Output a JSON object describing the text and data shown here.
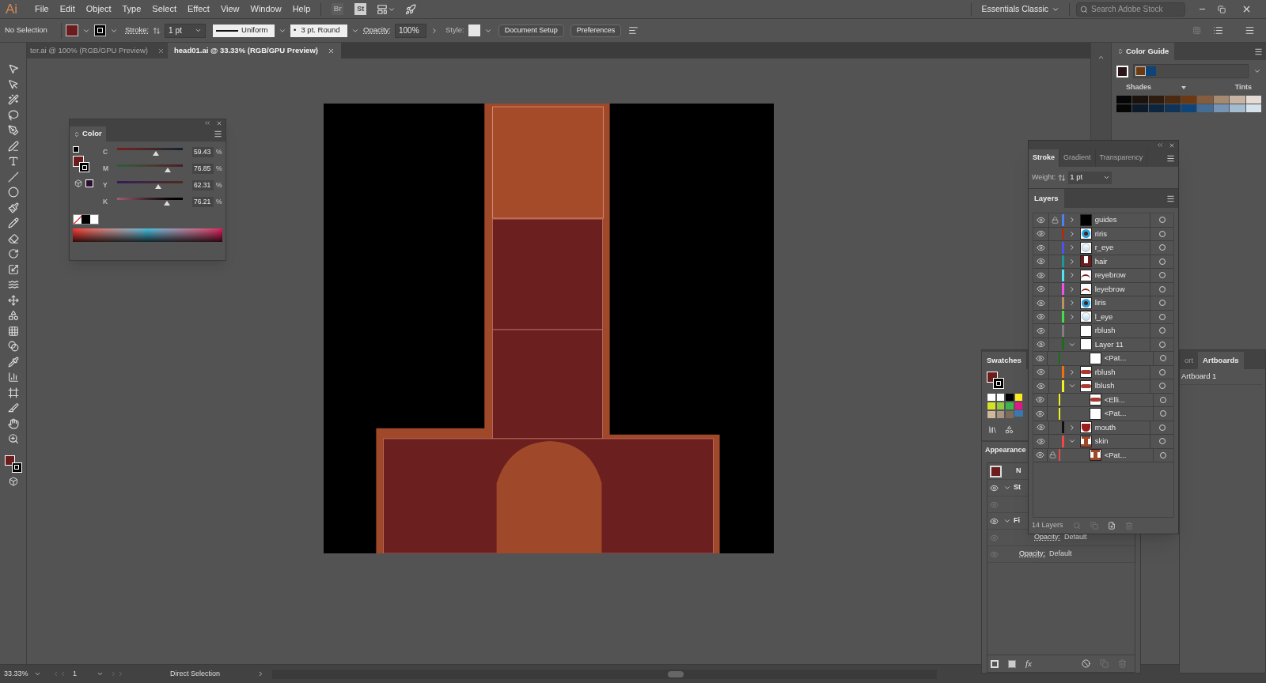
{
  "menu_bar": {
    "logo": "Ai",
    "items": [
      "File",
      "Edit",
      "Object",
      "Type",
      "Select",
      "Effect",
      "View",
      "Window",
      "Help"
    ],
    "app_badges": [
      "Br",
      "St"
    ],
    "workspace": "Essentials Classic",
    "search": {
      "placeholder": "Search Adobe Stock"
    }
  },
  "control_bar": {
    "selection": "No Selection",
    "stroke_label": "Stroke:",
    "stroke_weight": "1 pt",
    "profile": "Uniform",
    "brush_dot": "•",
    "brush": "3 pt. Round",
    "opacity_label": "Opacity:",
    "opacity": "100%",
    "style_label": "Style:",
    "buttons": [
      "Document Setup",
      "Preferences"
    ]
  },
  "document_tabs": [
    {
      "label": "ter.ai @ 100% (RGB/GPU Preview)",
      "selected": false
    },
    {
      "label": "head01.ai @ 33.33% (RGB/GPU Preview)",
      "selected": true
    }
  ],
  "color_panel": {
    "title": "Color",
    "channels": [
      {
        "name": "C",
        "level": 0.5943,
        "value": "59.43",
        "unit": "%"
      },
      {
        "name": "M",
        "level": 0.7685,
        "value": "76.85",
        "unit": "%"
      },
      {
        "name": "Y",
        "level": 0.6231,
        "value": "62.31",
        "unit": "%"
      },
      {
        "name": "K",
        "level": 0.7621,
        "value": "76.21",
        "unit": "%"
      }
    ]
  },
  "color_guide": {
    "title": "Color Guide",
    "shades_label": "Shades",
    "tints_label": "Tints"
  },
  "stroke_panel": {
    "tabs": [
      {
        "label": "Stroke",
        "selected": true
      },
      {
        "label": "Gradient",
        "selected": false
      },
      {
        "label": "Transparency",
        "selected": false
      }
    ],
    "weight_label": "Weight:",
    "weight": "1 pt"
  },
  "layers_panel": {
    "title": "Layers",
    "count": "14 Layers",
    "layers": [
      {
        "name": "guides",
        "color": "#4f7ff0",
        "locked": true,
        "kind": "group",
        "expanded": false
      },
      {
        "name": "riris",
        "color": "#a0311a",
        "locked": false,
        "kind": "group",
        "expanded": false
      },
      {
        "name": "r_eye",
        "color": "#5050f0",
        "locked": false,
        "kind": "group",
        "expanded": false
      },
      {
        "name": "hair",
        "color": "#1b9a9a",
        "locked": false,
        "kind": "group",
        "expanded": false
      },
      {
        "name": "reyebrow",
        "color": "#4ae8f0",
        "locked": false,
        "kind": "group",
        "expanded": false
      },
      {
        "name": "leyebrow",
        "color": "#f050f0",
        "locked": false,
        "kind": "group",
        "expanded": false
      },
      {
        "name": "liris",
        "color": "#c09060",
        "locked": false,
        "kind": "group",
        "expanded": false
      },
      {
        "name": "l_eye",
        "color": "#40e040",
        "locked": false,
        "kind": "group",
        "expanded": false
      },
      {
        "name": "rblush",
        "color": "#808080",
        "locked": false,
        "kind": "plain"
      },
      {
        "name": "Layer 11",
        "color": "#1a6e1a",
        "locked": false,
        "kind": "group",
        "expanded": true,
        "children": [
          {
            "name": "<Pat...",
            "locked": false
          }
        ]
      },
      {
        "name": "rblush",
        "color": "#f07010",
        "locked": false,
        "kind": "group",
        "expanded": false
      },
      {
        "name": "lblush",
        "color": "#f0f020",
        "locked": false,
        "kind": "group",
        "expanded": true,
        "children": [
          {
            "name": "<Elli...",
            "locked": false
          },
          {
            "name": "<Pat...",
            "locked": false
          }
        ]
      },
      {
        "name": "mouth",
        "color": "#101010",
        "locked": false,
        "kind": "group",
        "expanded": false
      },
      {
        "name": "skin",
        "color": "#f04848",
        "locked": false,
        "kind": "group",
        "expanded": true,
        "children": [
          {
            "name": "<Pat...",
            "locked": true
          }
        ]
      }
    ]
  },
  "swatches_panel": {
    "title": "Swatches"
  },
  "appearance_panel": {
    "title": "Appearance",
    "effects_label": "fx",
    "rows": [
      {
        "label": "N",
        "kind": "object"
      },
      {
        "label": "St",
        "kind": "stroke"
      },
      {
        "kind": "empty"
      },
      {
        "label": "Fi",
        "kind": "fill"
      }
    ],
    "opacity_rows": [
      {
        "label": "Opacity:",
        "value": "Default"
      },
      {
        "label": "Opacity:",
        "value": "Default"
      }
    ]
  },
  "artboards_panel": {
    "tabs": [
      {
        "label": "ort",
        "selected": false
      },
      {
        "label": "Artboards",
        "selected": true
      }
    ],
    "items": [
      "Artboard 1"
    ]
  },
  "status_bar": {
    "zoom": "33.33%",
    "artboard": "1",
    "tool": "Direct Selection"
  }
}
